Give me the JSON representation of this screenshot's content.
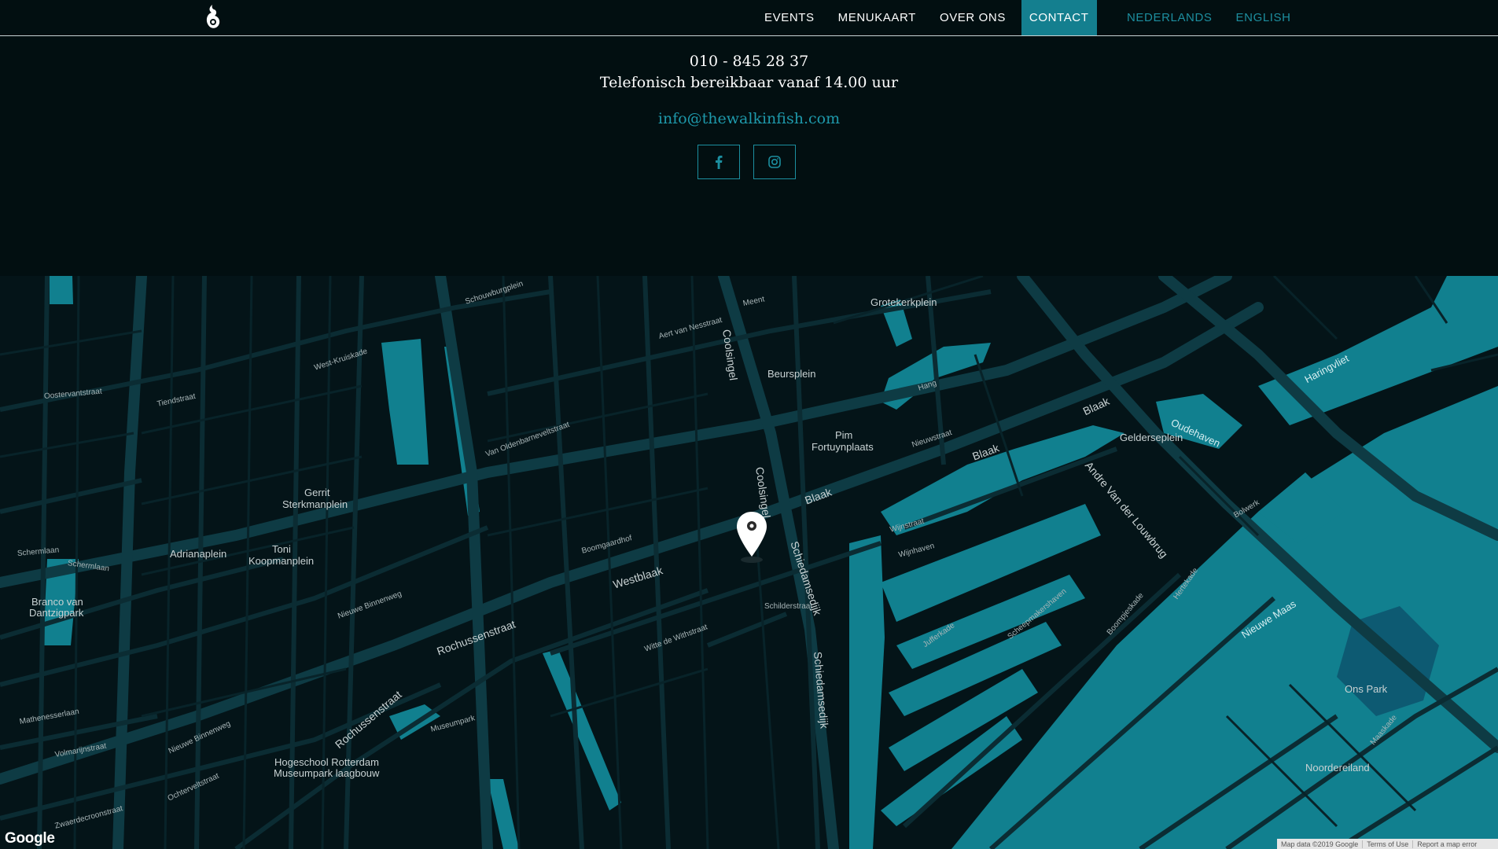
{
  "nav": {
    "items": [
      {
        "label": "EVENTS"
      },
      {
        "label": "MENUKAART"
      },
      {
        "label": "OVER ONS"
      },
      {
        "label": "CONTACT",
        "active": true
      }
    ],
    "languages": [
      {
        "label": "NEDERLANDS"
      },
      {
        "label": "ENGLISH"
      }
    ]
  },
  "contact": {
    "phone": "010 - 845 28 37",
    "hours": "Telefonisch bereikbaar vanaf 14.00 uur",
    "email": "info@thewalkinfish.com",
    "social": [
      "facebook-icon",
      "instagram-icon"
    ]
  },
  "colors": {
    "background": "#020f11",
    "accent": "#147f8f",
    "link": "#1e99ab",
    "water": "#11808f"
  },
  "map": {
    "labels": {
      "grotekerkplein": "Grotekerkplein",
      "beursplein": "Beursplein",
      "pim": "Pim",
      "fortuynplaats": "Fortuynplaats",
      "gelderseplein": "Gelderseplein",
      "gerrit": "Gerrit",
      "sterkmanplein": "Sterkmanplein",
      "adrianaplein": "Adrianaplein",
      "toni": "Toni",
      "koopmanplein": "Koopmanplein",
      "branco1": "Branco van",
      "branco2": "Dantzigpark",
      "hogeschool1": "Hogeschool Rotterdam",
      "hogeschool2": "Museumpark laagbouw",
      "onspark": "Ons Park",
      "noordereiland": "Noordereiland",
      "nieuwemaas": "Nieuwe Maas",
      "haringvliet": "Haringvliet",
      "oudehaven": "Oudehaven",
      "coolsingel1": "Coolsingel",
      "coolsingel2": "Coolsingel",
      "westblaak": "Westblaak",
      "rochussenstraat1": "Rochussenstraat",
      "rochussenstraat2": "Rochussenstraat",
      "schiedamsedijk1": "Schiedamsedijk",
      "schiedamsedijk2": "Schiedamsedijk",
      "blaak1": "Blaak",
      "blaak2": "Blaak",
      "blaak3": "Blaak",
      "andre": "Andre Van der Louwbrug",
      "westkruiskade": "West-Kruiskade",
      "tiendstraat": "Tiendstraat",
      "oostervantstraat": "Oostervantstraat",
      "schouwburgplein": "Schouwburgplein",
      "aertvannesstraat": "Aert van Nesstraat",
      "meent": "Meent",
      "vanoldenbarnevelt": "Van Oldenbarneveltstraat",
      "nieuwebinnenweg": "Nieuwe Binnenweg",
      "mathenesserlaan": "Mathenesserlaan",
      "volmarijnstraat": "Volmarijnstraat",
      "wittedewithstraat": "Witte de Withstraat",
      "schilderstraat": "Schilderstraat",
      "museumpark": "Museumpark",
      "boomgaardhof": "Boomgaardhof",
      "wijnstraat": "Wijnstraat",
      "wijnhaven": "Wijnhaven",
      "nieuwstraat": "Nieuwstraat",
      "hang": "Hang",
      "jufferkade": "Jufferkade",
      "boompjeskade": "Boompjeskade",
      "schermlaan1": "Schermlaan",
      "schermlaan2": "Schermlaan",
      "zwaerdecroonstraat": "Zwaerdecroonstraat",
      "ochtervestraat": "Ochterveltstraat",
      "nieuweweg": "Nieuwe Binnenweg",
      "maaskade": "Maaskade",
      "hertekade": "Hertekade",
      "bolwerk": "Bolwerk",
      "scheepmakershaven": "Scheepmakershaven"
    },
    "google_logo": "Google",
    "attribution": [
      "Map data ©2019 Google",
      "Terms of Use",
      "Report a map error"
    ]
  }
}
